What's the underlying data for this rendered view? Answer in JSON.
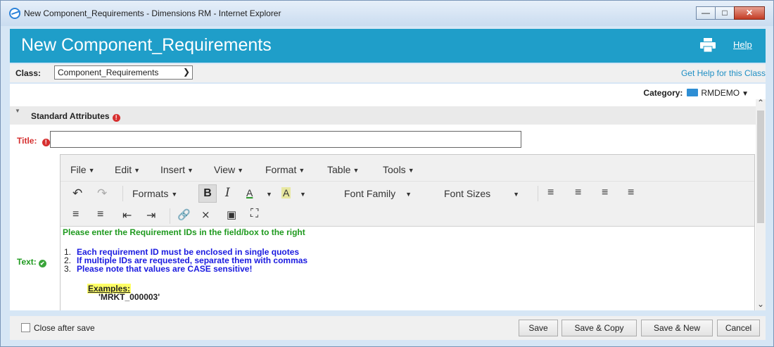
{
  "window": {
    "title": "New Component_Requirements - Dimensions RM - Internet Explorer"
  },
  "header": {
    "title": "New Component_Requirements",
    "help_label": "Help"
  },
  "class_row": {
    "label": "Class:",
    "selected": "Component_Requirements",
    "get_help": "Get Help for this Class"
  },
  "category": {
    "label": "Category:",
    "value": "RMDEMO"
  },
  "section": {
    "title": "Standard Attributes"
  },
  "title_field": {
    "label": "Title:",
    "value": ""
  },
  "editor": {
    "menus": [
      "File",
      "Edit",
      "Insert",
      "View",
      "Format",
      "Table",
      "Tools"
    ],
    "formats_label": "Formats",
    "bold": "B",
    "italic": "I",
    "font_color": "A",
    "bg_color": "A",
    "font_family": "Font Family",
    "font_sizes": "Font Sizes",
    "instructions": "Please enter the Requirement IDs in the field/box to the right",
    "list": [
      {
        "num": "1.",
        "text": "Each requirement ID must be enclosed in single quotes"
      },
      {
        "num": "2.",
        "text": "If multiple IDs are requested, separate them with commas"
      },
      {
        "num": "3.",
        "text": "Please note that values are CASE sensitive!"
      }
    ],
    "examples_label": "Examples:",
    "example_value": "'MRKT_000003'"
  },
  "text_field": {
    "label": "Text:"
  },
  "footer": {
    "close_after_save": "Close after save",
    "save": "Save",
    "save_copy": "Save & Copy",
    "save_new": "Save & New",
    "cancel": "Cancel"
  },
  "colors": {
    "header": "#1f9ec9",
    "required": "#d52f2f",
    "instructions": "#1f9a1f",
    "list_text": "#1a1ae0"
  }
}
